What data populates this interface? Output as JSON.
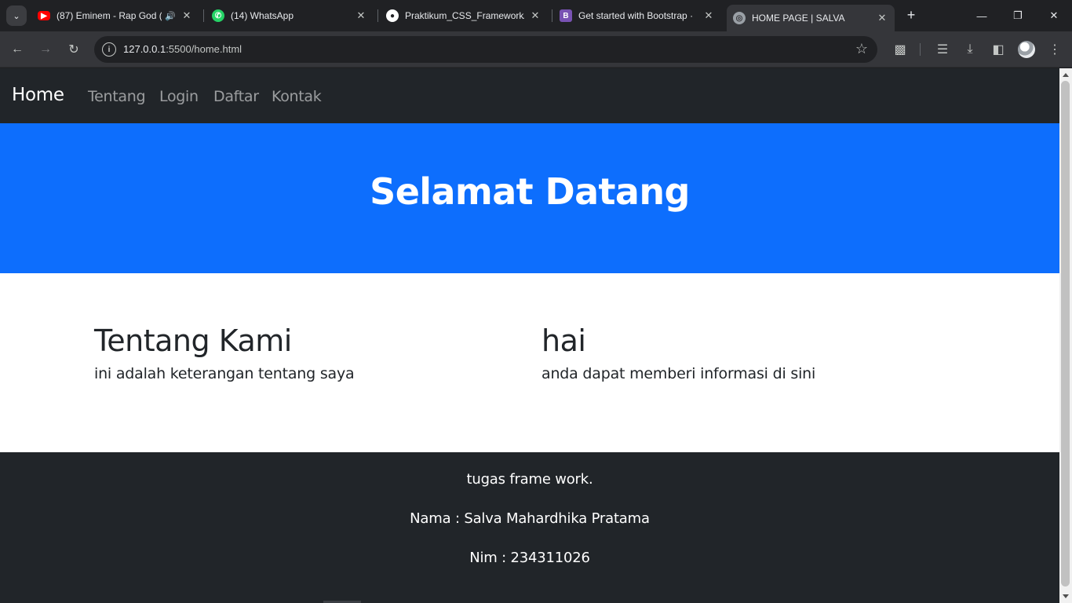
{
  "browser": {
    "tabs": [
      {
        "title": "(87) Eminem - Rap God (",
        "icon": "youtube-icon",
        "active": false
      },
      {
        "title": "(14) WhatsApp",
        "icon": "whatsapp-icon",
        "active": false
      },
      {
        "title": "Praktikum_CSS_Framework/",
        "icon": "github-icon",
        "active": false
      },
      {
        "title": "Get started with Bootstrap ·",
        "icon": "bootstrap-icon",
        "active": false
      },
      {
        "title": "HOME PAGE | SALVA",
        "icon": "globe-icon",
        "active": true
      }
    ],
    "address_host": "127.0.0.1",
    "address_rest": ":5500/home.html",
    "colors": {
      "youtube": "#ff0000",
      "whatsapp": "#25d366",
      "bootstrap": "#7952b3"
    }
  },
  "page": {
    "navbar": {
      "brand": "Home",
      "links": [
        "Tentang",
        "Login",
        "Daftar",
        "Kontak"
      ]
    },
    "hero": {
      "title": "Selamat Datang"
    },
    "sections": [
      {
        "heading": "Tentang Kami",
        "text": "ini adalah keterangan tentang saya"
      },
      {
        "heading": "hai",
        "text": "anda dapat memberi informasi di sini"
      }
    ],
    "footer": {
      "line1": "tugas frame work.",
      "line2": "Nama : Salva Mahardhika Pratama",
      "line3": "Nim : 234311026"
    },
    "colors": {
      "navbar": "#212529",
      "hero": "#0d6efd",
      "footer": "#212529"
    }
  }
}
